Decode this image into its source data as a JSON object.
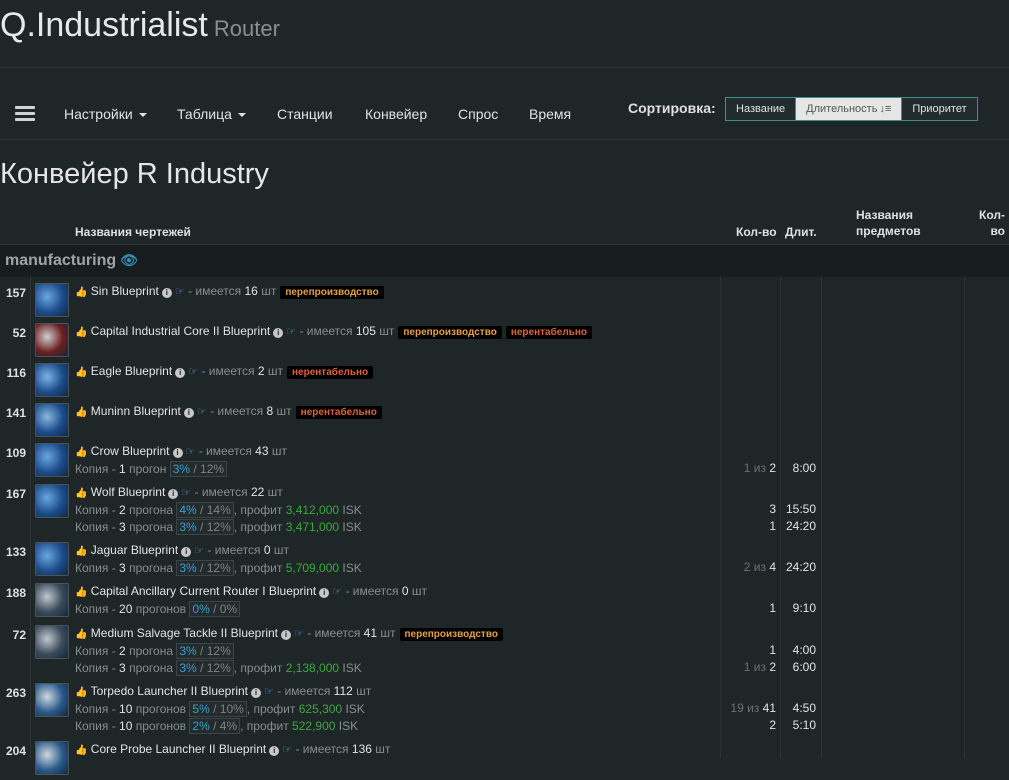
{
  "brand": {
    "title": "Q.Industrialist",
    "subtitle": "Router"
  },
  "nav": {
    "items": [
      {
        "label": "Настройки",
        "dropdown": true
      },
      {
        "label": "Таблица",
        "dropdown": true
      },
      {
        "label": "Станции",
        "dropdown": false
      },
      {
        "label": "Конвейер",
        "dropdown": false
      },
      {
        "label": "Спрос",
        "dropdown": false
      },
      {
        "label": "Время",
        "dropdown": false
      }
    ],
    "sort_label": "Сортировка:",
    "sort_options": [
      "Название",
      "Длительность",
      "Приоритет"
    ],
    "sort_active": "Длительность",
    "sort_icon": "sort-amount-desc-icon"
  },
  "page_title": "Конвейер R Industry",
  "table": {
    "headers": {
      "blueprints": "Названия чертежей",
      "qty": "Кол-во",
      "duration": "Длит.",
      "products_line1": "Названия",
      "products_line2": "предметов",
      "products_qty_line1": "Кол-",
      "products_qty_line2": "во"
    },
    "group": {
      "label": "manufacturing",
      "icon": "eye-icon"
    },
    "rows": [
      {
        "num": "157",
        "name": "Sin Blueprint",
        "have_text": "- имеется",
        "have": "16",
        "unit": "шт",
        "tags": [
          {
            "text": "перепроизводство",
            "kind": "over"
          }
        ],
        "jobs": []
      },
      {
        "num": "52",
        "name": "Capital Industrial Core II Blueprint",
        "have_text": "- имеется",
        "have": "105",
        "unit": "шт",
        "tags": [
          {
            "text": "перепроизводство",
            "kind": "over"
          },
          {
            "text": "нерентабельно",
            "kind": "warn"
          }
        ],
        "jobs": []
      },
      {
        "num": "116",
        "name": "Eagle Blueprint",
        "have_text": "- имеется",
        "have": "2",
        "unit": "шт",
        "tags": [
          {
            "text": "нерентабельно",
            "kind": "warn"
          }
        ],
        "jobs": []
      },
      {
        "num": "141",
        "name": "Muninn Blueprint",
        "have_text": "- имеется",
        "have": "8",
        "unit": "шт",
        "tags": [
          {
            "text": "нерентабельно",
            "kind": "warn"
          }
        ],
        "jobs": []
      },
      {
        "num": "109",
        "name": "Crow Blueprint",
        "have_text": "- имеется",
        "have": "43",
        "unit": "шт",
        "tags": [],
        "jobs": [
          {
            "prefix": "Копия -",
            "runs": "1",
            "runs_word": "прогон",
            "me": "3%",
            "te": "12%",
            "profit": "",
            "qty": "1 из 2",
            "dur": "8:00"
          }
        ]
      },
      {
        "num": "167",
        "name": "Wolf Blueprint",
        "have_text": "- имеется",
        "have": "22",
        "unit": "шт",
        "tags": [],
        "jobs": [
          {
            "prefix": "Копия -",
            "runs": "2",
            "runs_word": "прогона",
            "me": "4%",
            "te": "14%",
            "profit": "3,412,000",
            "qty": "3",
            "dur": "15:50"
          },
          {
            "prefix": "Копия -",
            "runs": "3",
            "runs_word": "прогона",
            "me": "3%",
            "te": "12%",
            "profit": "3,471,000",
            "qty": "1",
            "dur": "24:20"
          }
        ]
      },
      {
        "num": "133",
        "name": "Jaguar Blueprint",
        "have_text": "- имеется",
        "have": "0",
        "unit": "шт",
        "tags": [],
        "jobs": [
          {
            "prefix": "Копия -",
            "runs": "3",
            "runs_word": "прогона",
            "me": "3%",
            "te": "12%",
            "profit": "5,709,000",
            "qty": "2 из 4",
            "dur": "24:20"
          }
        ]
      },
      {
        "num": "188",
        "name": "Capital Ancillary Current Router I Blueprint",
        "have_text": "- имеется",
        "have": "0",
        "unit": "шт",
        "tags": [],
        "jobs": [
          {
            "prefix": "Копия -",
            "runs": "20",
            "runs_word": "прогонов",
            "me": "0%",
            "te": "0%",
            "profit": "",
            "qty": "1",
            "dur": "9:10"
          }
        ]
      },
      {
        "num": "72",
        "name": "Medium Salvage Tackle II Blueprint",
        "have_text": "- имеется",
        "have": "41",
        "unit": "шт",
        "tags": [
          {
            "text": "перепроизводство",
            "kind": "over"
          }
        ],
        "jobs": [
          {
            "prefix": "Копия -",
            "runs": "2",
            "runs_word": "прогона",
            "me": "3%",
            "te": "12%",
            "profit": "",
            "qty": "1",
            "dur": "4:00"
          },
          {
            "prefix": "Копия -",
            "runs": "3",
            "runs_word": "прогона",
            "me": "3%",
            "te": "12%",
            "profit": "2,138,000",
            "qty": "1 из 2",
            "dur": "6:00"
          }
        ]
      },
      {
        "num": "263",
        "name": "Torpedo Launcher II Blueprint",
        "have_text": "- имеется",
        "have": "112",
        "unit": "шт",
        "tags": [],
        "jobs": [
          {
            "prefix": "Копия -",
            "runs": "10",
            "runs_word": "прогонов",
            "me": "5%",
            "te": "10%",
            "profit": "625,300",
            "qty": "19 из 41",
            "dur": "4:50"
          },
          {
            "prefix": "Копия -",
            "runs": "10",
            "runs_word": "прогонов",
            "me": "2%",
            "te": "4%",
            "profit": "522,900",
            "qty": "2",
            "dur": "5:10"
          }
        ]
      },
      {
        "num": "204",
        "name": "Core Probe Launcher II Blueprint",
        "have_text": "- имеется",
        "have": "136",
        "unit": "шт",
        "tags": [],
        "jobs": []
      }
    ],
    "profit_label": ", профит",
    "currency": "ISK"
  }
}
